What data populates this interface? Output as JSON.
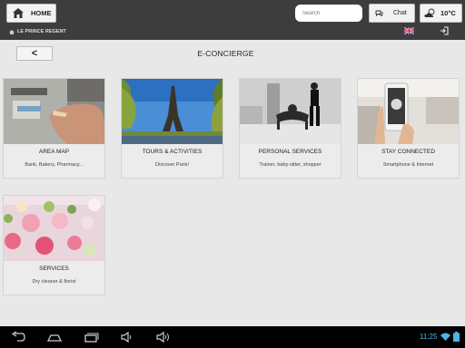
{
  "topbar": {
    "home_label": "HOME",
    "search_placeholder": "Search",
    "chat_label": "Chat",
    "temperature": "10°C",
    "hotel_name": "LE PRINCE REGENT"
  },
  "main": {
    "back_label": "<",
    "title": "E-CONCIERGE",
    "cards": [
      {
        "title": "AREA MAP",
        "subtitle": "Bank, Bakery, Pharmacy..."
      },
      {
        "title": "TOURS & ACTIVITIES",
        "subtitle": "Discover Paris!"
      },
      {
        "title": "PERSONAL SERVICES",
        "subtitle": "Trainer, baby-sitter, shopper"
      },
      {
        "title": "STAY CONNECTED",
        "subtitle": "Smartphone & Internet"
      },
      {
        "title": "SERVICES",
        "subtitle": "Dry cleaner & florist"
      }
    ]
  },
  "navbar": {
    "time": "11:25",
    "icons": [
      "back-icon",
      "home-icon",
      "recent-apps-icon",
      "volume-down-icon",
      "volume-up-icon",
      "wifi-icon",
      "battery-icon"
    ]
  },
  "colors": {
    "topbar": "#3d3d3d",
    "background": "#e8e8e8",
    "clock": "#4db5e0"
  }
}
